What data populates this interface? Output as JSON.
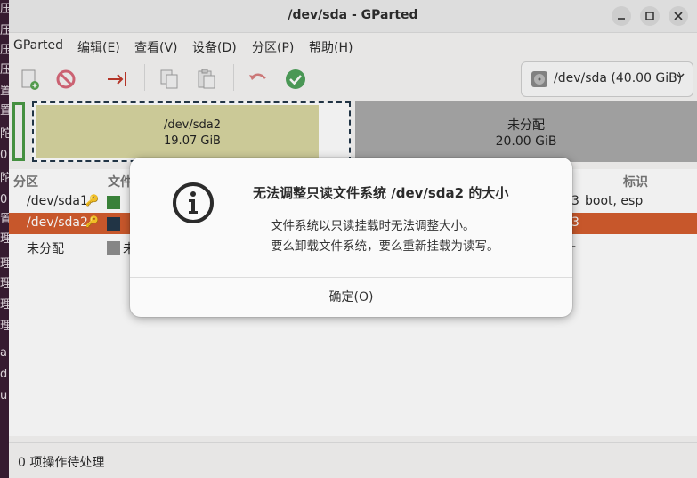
{
  "window": {
    "title": "/dev/sda - GParted"
  },
  "desktop_strip": {
    "chars": [
      "压",
      "压",
      "压",
      "压",
      "置",
      "置",
      "陀",
      "0",
      "陀",
      "0",
      "置",
      "理",
      "理",
      "理",
      "理",
      "理",
      "a",
      "d",
      "u"
    ]
  },
  "menubar": {
    "items": [
      "GParted",
      "编辑(E)",
      "查看(V)",
      "设备(D)",
      "分区(P)",
      "帮助(H)"
    ]
  },
  "toolbar": {
    "icons": [
      "new-partition-icon",
      "delete-icon",
      "resize-move-icon",
      "copy-icon",
      "paste-icon",
      "undo-icon",
      "apply-icon"
    ],
    "device_selector": {
      "label": "/dev/sda (40.00 GiB)",
      "icon": "disk-icon"
    }
  },
  "diskmap": {
    "sda2": {
      "name": "/dev/sda2",
      "size": "19.07 GiB"
    },
    "unallocated": {
      "name": "未分配",
      "size": "20.00 GiB"
    }
  },
  "partition_list": {
    "headers": {
      "partition": "分区",
      "filesystem": "文件",
      "flags": "标识"
    },
    "rows": [
      {
        "name": "/dev/sda1",
        "color": "#3d8a3d",
        "flags_tail": "3",
        "flags": "boot, esp",
        "selected": false
      },
      {
        "name": "/dev/sda2",
        "color": "#24384a",
        "flags_tail": "3",
        "flags": "",
        "selected": true
      },
      {
        "name": "未分配",
        "color": "#8f8f8f",
        "fs_partial": "未",
        "flags_tail": "-",
        "flags": "",
        "selected": false
      }
    ]
  },
  "statusbar": {
    "text": "0 项操作待处理"
  },
  "dialog": {
    "icon": "info-icon",
    "title": "无法调整只读文件系统 /dev/sda2 的大小",
    "message_line1": "文件系统以只读挂载时无法调整大小。",
    "message_line2": "要么卸载文件系统，要么重新挂载为读写。",
    "ok_label": "确定(O)"
  },
  "colors": {
    "selection": "#d45d2e",
    "esp_border": "#4a9a45",
    "sda2_used": "#d8d6a1",
    "unallocated": "#a9a9a9"
  }
}
